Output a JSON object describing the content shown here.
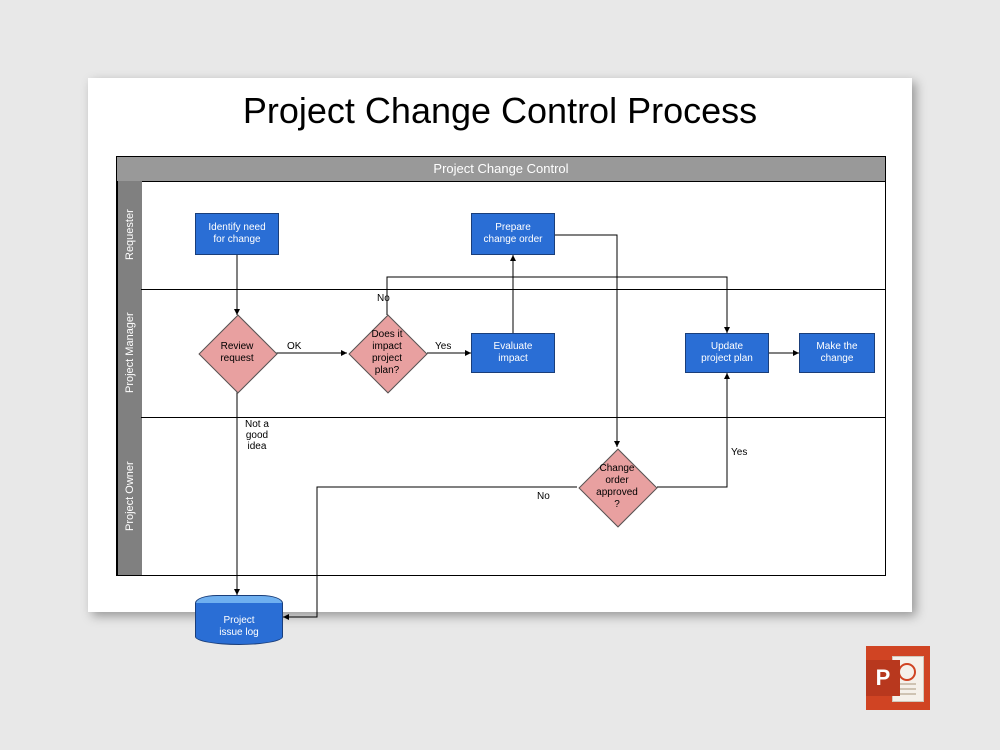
{
  "title": "Project Change Control Process",
  "pool_header": "Project Change Control",
  "lanes": {
    "requester": "Requester",
    "pm": "Project Manager",
    "owner": "Project Owner"
  },
  "nodes": {
    "identify": "Identify need\nfor change",
    "review": "Review\nrequest",
    "impact_q": "Does it\nimpact\nproject\nplan?",
    "evaluate": "Evaluate\nimpact",
    "prepare": "Prepare\nchange order",
    "approved_q": "Change\norder\napproved\n?",
    "update": "Update\nproject plan",
    "make": "Make the\nchange",
    "log": "Project\nissue log"
  },
  "edge_labels": {
    "ok": "OK",
    "not_good": "Not a\ngood\nidea",
    "no1": "No",
    "yes1": "Yes",
    "yes2": "Yes",
    "no2": "No"
  },
  "icon": {
    "letter": "P"
  }
}
